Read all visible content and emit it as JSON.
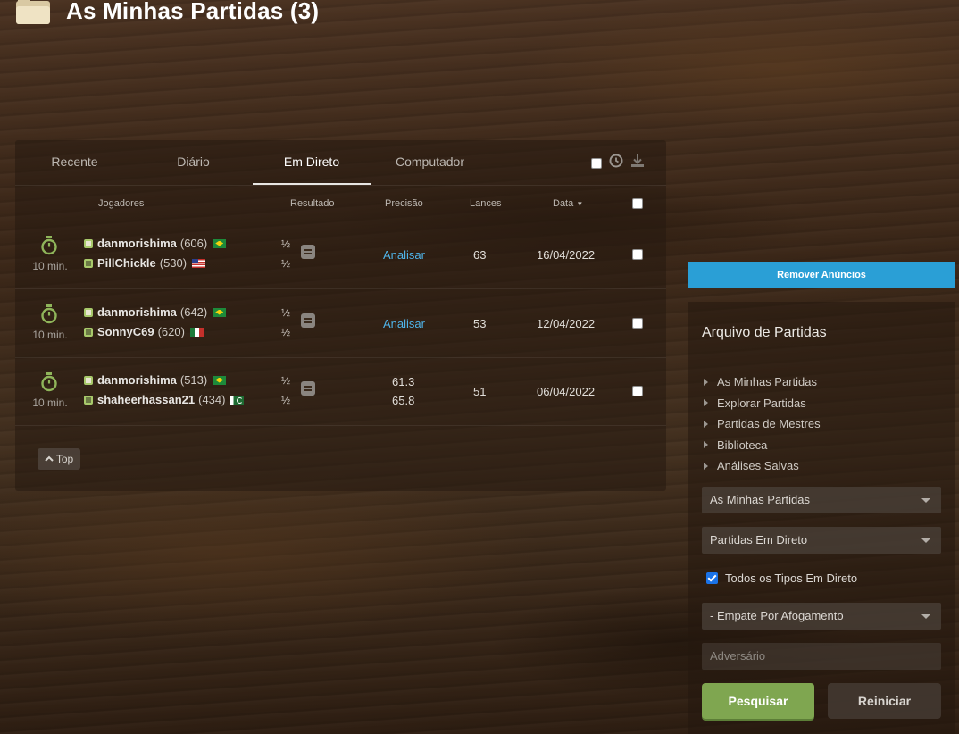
{
  "header": {
    "title": "As Minhas Partidas (3)",
    "icon": "folder-icon"
  },
  "tabs": [
    {
      "label": "Recente",
      "active": false
    },
    {
      "label": "Diário",
      "active": false
    },
    {
      "label": "Em Direto",
      "active": true
    },
    {
      "label": "Computador",
      "active": false
    }
  ],
  "table": {
    "columns": {
      "players": "Jogadores",
      "result": "Resultado",
      "accuracy": "Precisão",
      "moves": "Lances",
      "date": "Data"
    },
    "rows": [
      {
        "time": "10 min.",
        "white": {
          "name": "danmorishima",
          "rating": "(606)",
          "flag": "br"
        },
        "black": {
          "name": "PillChickle",
          "rating": "(530)",
          "flag": "us"
        },
        "result_white": "½",
        "result_black": "½",
        "accuracy_link": "Analisar",
        "moves": "63",
        "date": "16/04/2022"
      },
      {
        "time": "10 min.",
        "white": {
          "name": "danmorishima",
          "rating": "(642)",
          "flag": "br"
        },
        "black": {
          "name": "SonnyC69",
          "rating": "(620)",
          "flag": "mx"
        },
        "result_white": "½",
        "result_black": "½",
        "accuracy_link": "Analisar",
        "moves": "53",
        "date": "12/04/2022"
      },
      {
        "time": "10 min.",
        "white": {
          "name": "danmorishima",
          "rating": "(513)",
          "flag": "br"
        },
        "black": {
          "name": "shaheerhassan21",
          "rating": "(434)",
          "flag": "pk"
        },
        "result_white": "½",
        "result_black": "½",
        "accuracy_white": "61.3",
        "accuracy_black": "65.8",
        "moves": "51",
        "date": "06/04/2022"
      }
    ],
    "top_button": "Top"
  },
  "sidebar": {
    "remove_ads": "Remover Anúncios",
    "archive_title": "Arquivo de Partidas",
    "links": [
      "As Minhas Partidas",
      "Explorar Partidas",
      "Partidas de Mestres",
      "Biblioteca",
      "Análises Salvas"
    ],
    "select_games": "As Minhas Partidas",
    "select_type": "Partidas Em Direto",
    "checkbox_label": "Todos os Tipos Em Direto",
    "select_result": "- Empate Por Afogamento",
    "opponent_placeholder": "Adversário",
    "search_button": "Pesquisar",
    "reset_button": "Reiniciar"
  },
  "colors": {
    "accent_blue": "#2a9fd6",
    "search_green": "#7fa650",
    "link_blue": "#4fb3e8"
  }
}
